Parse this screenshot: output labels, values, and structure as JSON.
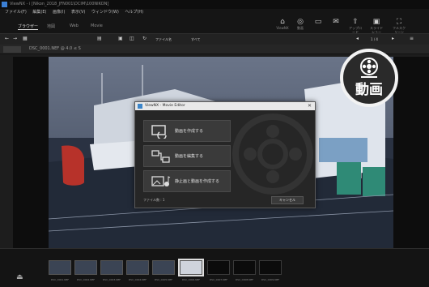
{
  "window": {
    "title": "ViewNX - i [Nikon_2018_JFN001\\DCIM\\100NIKON]"
  },
  "menu": [
    "ファイル(F)",
    "編集(E)",
    "画像(I)",
    "表示(V)",
    "ウィンドウ(W)",
    "ヘルプ(H)"
  ],
  "tabs": [
    {
      "label": "ブラウザー",
      "active": true
    },
    {
      "label": "地図"
    },
    {
      "label": "Web"
    },
    {
      "label": "Movie"
    }
  ],
  "top_icons": [
    {
      "icon": "viewnx-icon",
      "label": "ViewNX"
    },
    {
      "label": "動画"
    },
    {
      "label": ""
    },
    {
      "label": ""
    },
    {
      "label": "アップロード"
    },
    {
      "label": "スライドショー"
    },
    {
      "label": "フルスクリーン"
    }
  ],
  "toolbar": {
    "page_counter": "1 / 4",
    "sort_label": "ファイル名",
    "filter_label": "すべて"
  },
  "address": {
    "crumb": "DSC_0001.NEF  @ 4.0 ≤ S"
  },
  "dialog": {
    "title": "ViewNX - Movie Editor",
    "buttons": [
      {
        "label": "動画を作成する",
        "icon": "movie-create-icon"
      },
      {
        "label": "動画を編集する",
        "icon": "movie-edit-icon"
      },
      {
        "label": "静止画と動画を作成する",
        "icon": "photo-movie-icon"
      }
    ],
    "footer_text": "ファイル数 : 1",
    "cancel_label": "キャンセル"
  },
  "callout": {
    "label": "動画",
    "icon": "movie-reel-icon"
  },
  "thumbnails": [
    {
      "label": "DSC_0001.NEF"
    },
    {
      "label": "DSC_0002.NEF"
    },
    {
      "label": "DSC_0003.NEF"
    },
    {
      "label": "DSC_0004.NEF"
    },
    {
      "label": "DSC_0005.NEF"
    },
    {
      "label": "DSC_0006.NEF"
    },
    {
      "label": "DSC_0007.NEF"
    },
    {
      "label": "DSC_0008.NEF"
    },
    {
      "label": "DSC_0009.NEF"
    }
  ]
}
